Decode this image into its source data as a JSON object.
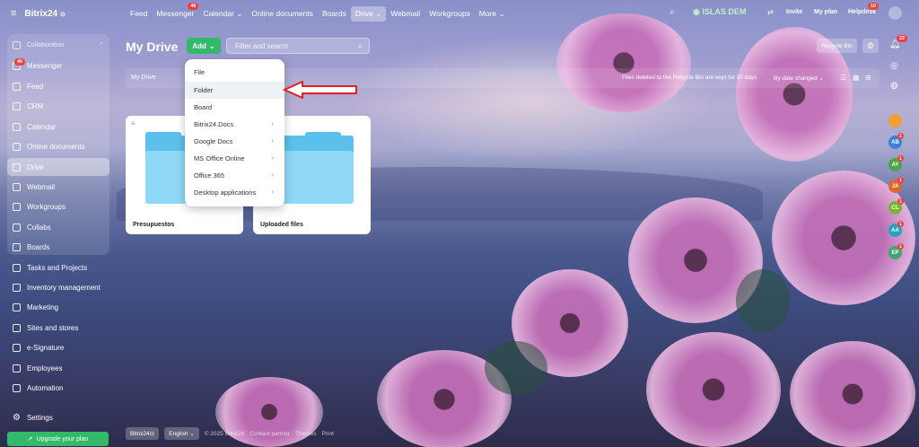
{
  "app": {
    "name": "Bitrix24",
    "logo_suffix": "⊙"
  },
  "topnav": [
    {
      "label": "Feed"
    },
    {
      "label": "Messenger",
      "badge": "46"
    },
    {
      "label": "Calendar ⌄"
    },
    {
      "label": "Online documents"
    },
    {
      "label": "Boards"
    },
    {
      "label": "Drive ⌄"
    },
    {
      "label": "Webmail"
    },
    {
      "label": "Workgroups"
    },
    {
      "label": "More ⌄"
    }
  ],
  "topright": {
    "company": "ISLAS DEM",
    "invite": "Invite",
    "myplan": "My plan",
    "helpdesk": "Helpdesk",
    "helpdesk_badge": "10"
  },
  "sidebar": {
    "section": "Collaboration",
    "items": [
      {
        "label": "Messenger",
        "badge": "46"
      },
      {
        "label": "Feed"
      },
      {
        "label": "CRM"
      },
      {
        "label": "Calendar"
      },
      {
        "label": "Online documents"
      },
      {
        "label": "Drive"
      },
      {
        "label": "Webmail"
      },
      {
        "label": "Workgroups"
      },
      {
        "label": "Collabs"
      },
      {
        "label": "Boards"
      },
      {
        "label": "Tasks and Projects"
      },
      {
        "label": "Inventory management"
      },
      {
        "label": "Marketing"
      },
      {
        "label": "Sites and stores"
      },
      {
        "label": "e-Signature"
      },
      {
        "label": "Employees"
      },
      {
        "label": "Automation"
      }
    ],
    "settings": "Settings",
    "upgrade": "Upgrade your plan"
  },
  "main": {
    "title": "My Drive",
    "add_label": "Add",
    "search_placeholder": "Filter and search",
    "recycle": "Recycle Bin",
    "crumb": "My Drive",
    "note": "Files deleted to the Recycle Bin are kept for 30 days",
    "sort": "By date changed ⌄",
    "cards": [
      {
        "name": "Presupuestos"
      },
      {
        "name": "Uploaded files"
      }
    ]
  },
  "dropdown": [
    {
      "label": "File",
      "sub": false
    },
    {
      "label": "Folder",
      "sub": false
    },
    {
      "label": "Board",
      "sub": false
    },
    {
      "label": "Bitrix24.Docs",
      "sub": true
    },
    {
      "label": "Google Docs",
      "sub": true
    },
    {
      "label": "MS Office Online",
      "sub": true
    },
    {
      "label": "Office 365",
      "sub": true
    },
    {
      "label": "Desktop applications",
      "sub": true
    }
  ],
  "rightbar": {
    "notif_badge": "22",
    "avatars": [
      {
        "initials": "AB",
        "color": "#3f7fd8"
      },
      {
        "initials": "AY",
        "color": "#4fa34a"
      },
      {
        "initials": "JA",
        "color": "#e0662f"
      },
      {
        "initials": "CL",
        "color": "#7ab534"
      },
      {
        "initials": "AA",
        "color": "#25a3b8"
      },
      {
        "initials": "EP",
        "color": "#3aa86f"
      }
    ]
  },
  "footer": {
    "brand": "Bitrix24⊙",
    "lang": "English ⌄",
    "copyright": "© 2025 Bitrix24",
    "partner": "Contact partner",
    "themes": "Themes",
    "print": "Print"
  }
}
